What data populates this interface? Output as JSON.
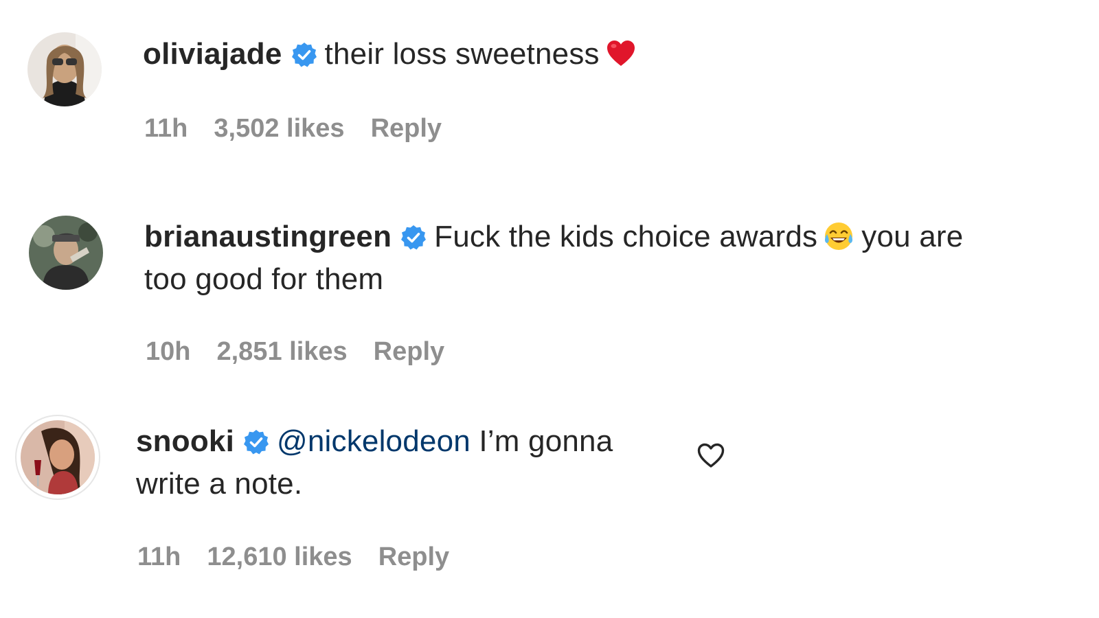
{
  "comments": [
    {
      "username": "oliviajade",
      "text": "their loss sweetness",
      "emoji": "red-heart-emoji",
      "time": "11h",
      "likes": "3,502 likes",
      "reply": "Reply"
    },
    {
      "username": "brianaustingreen",
      "text_before_emoji": "Fuck the kids choice awards",
      "emoji": "tears-of-joy-emoji",
      "text_after_emoji": "you are",
      "text_line2": "too good for them",
      "time": "10h",
      "likes": "2,851 likes",
      "reply": "Reply"
    },
    {
      "username": "snooki",
      "mention": "@nickelodeon",
      "text_line1": "I’m gonna",
      "text_line2": "write a note.",
      "time": "11h",
      "likes": "12,610 likes",
      "reply": "Reply"
    }
  ],
  "icons": {
    "verified": "verified-badge-icon",
    "like": "heart-outline-icon"
  },
  "colors": {
    "verified_blue": "#3897f0",
    "mention_blue": "#00376b",
    "meta_gray": "#8e8e8e",
    "text": "#262626",
    "emoji_heart_red": "#e0162b"
  }
}
